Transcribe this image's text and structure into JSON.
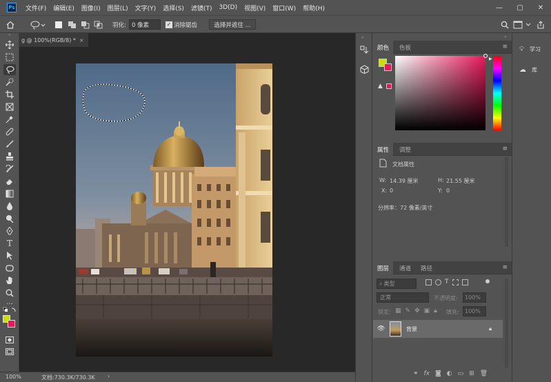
{
  "menubar": {
    "logo": "Ps",
    "items": [
      "文件(F)",
      "编辑(E)",
      "图像(I)",
      "图层(L)",
      "文字(Y)",
      "选择(S)",
      "滤镜(T)",
      "3D(D)",
      "视图(V)",
      "窗口(W)",
      "帮助(H)"
    ],
    "minimize": "—",
    "restore": "▢",
    "close": "✕"
  },
  "options": {
    "feather_label": "羽化:",
    "feather_value": "0 像素",
    "antialias_label": "消除锯齿",
    "select_mask_label": "选择并遮住 ..."
  },
  "document": {
    "tab_title": "g @ 100%(RGB/8) *",
    "close": "×"
  },
  "status": {
    "zoom": "100%",
    "doc_info": "文档:730.3K/730.3K",
    "arrow": "›"
  },
  "colors": {
    "foreground": "#c8e000",
    "background": "#e8185a",
    "hue_base": "#e8185a",
    "warning_swatch": "#e8185a"
  },
  "color_panel": {
    "tabs": [
      "颜色",
      "色板"
    ]
  },
  "properties_panel": {
    "tabs": [
      "属性",
      "调整"
    ],
    "doc_props": "文档属性",
    "w_label": "W:",
    "w_value": "14.39 厘米",
    "h_label": "H:",
    "h_value": "21.55 厘米",
    "x_label": "X:",
    "x_value": "0",
    "y_label": "Y:",
    "y_value": "0",
    "resolution": "分辨率：72 像素/英寸"
  },
  "layers_panel": {
    "tabs": [
      "图层",
      "通道",
      "路径"
    ],
    "filter_kind": "类型",
    "blend_mode": "正常",
    "opacity_label": "不透明度:",
    "opacity_value": "100%",
    "lock_label": "锁定:",
    "fill_label": "填充:",
    "fill_value": "100%",
    "layers": [
      {
        "name": "背景",
        "visible": true,
        "locked": true
      }
    ]
  },
  "right_strip": {
    "learn": "学习",
    "libraries": "库"
  },
  "icons": [
    "move-icon",
    "marquee-icon",
    "lasso-icon",
    "quick-select-icon",
    "crop-icon",
    "frame-icon",
    "eyedropper-icon",
    "healing-icon",
    "brush-icon",
    "stamp-icon",
    "history-brush-icon",
    "eraser-icon",
    "gradient-icon",
    "blur-icon",
    "dodge-icon",
    "pen-icon",
    "type-icon",
    "path-select-icon",
    "shape-icon",
    "hand-icon",
    "zoom-icon",
    "more-icon"
  ]
}
